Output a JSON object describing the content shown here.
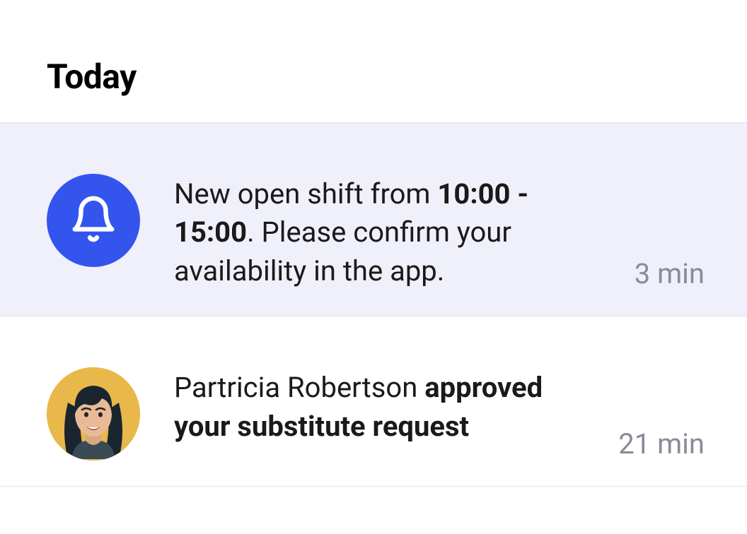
{
  "header": {
    "title": "Today"
  },
  "notifications": [
    {
      "icon": "bell-icon",
      "text_before": "New open shift from ",
      "text_bold": "10:00 - 15:00",
      "text_after": ". Please confirm your availability in the app.",
      "time": "3 min",
      "highlighted": true
    },
    {
      "icon": "avatar",
      "text_before": "Partricia Robertson ",
      "text_bold": "approved your substitute request",
      "text_after": "",
      "time": "21 min",
      "highlighted": false
    }
  ],
  "colors": {
    "accent": "#3355ee",
    "highlight_bg": "#f0f0fa",
    "text_muted": "#8a8a9a",
    "border": "#e1e1e8"
  }
}
